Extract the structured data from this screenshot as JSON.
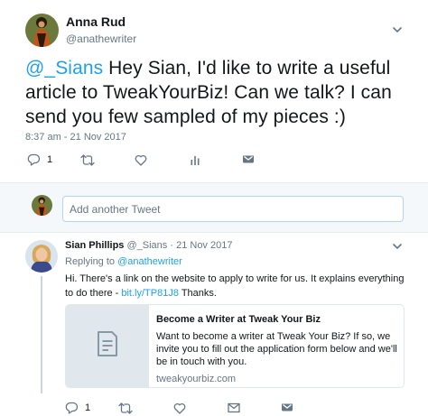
{
  "main_tweet": {
    "author_name": "Anna Rud",
    "author_handle": "@anathewriter",
    "mention": "@_Sians",
    "text": " Hey Sian, I'd like to write a useful article to TweakYourBiz! Can we talk? I can send you few sampled of my pieces :)",
    "timestamp": "8:37 am - 21 Nov 2017",
    "reply_count": "1",
    "retweet_count": "",
    "like_count": ""
  },
  "composer": {
    "placeholder": "Add another Tweet"
  },
  "reply_tweet": {
    "author_name": "Sian Phillips",
    "author_handle": "@_Sians",
    "separator": "·",
    "date": "21 Nov 2017",
    "replying_prefix": "Replying to",
    "replying_to": "@anathewriter",
    "text_before_link": "Hi. There's a link on the website to apply to write for us. It explains everything to do there - ",
    "link": "bit.ly/TP81J8",
    "text_after_link": " Thanks.",
    "reply_count": "1",
    "card": {
      "title": "Become a Writer at Tweak Your Biz",
      "description": "Want to become a writer at Tweak Your Biz? If so, we invite you to fill out the application form below and we'll be in touch with you.",
      "domain": "tweakyourbiz.com"
    }
  },
  "colors": {
    "accent": "#1da1f2",
    "muted": "#657786",
    "text": "#14171a",
    "divider": "#e6ecf0",
    "composer_bg": "#f5f8fa"
  }
}
